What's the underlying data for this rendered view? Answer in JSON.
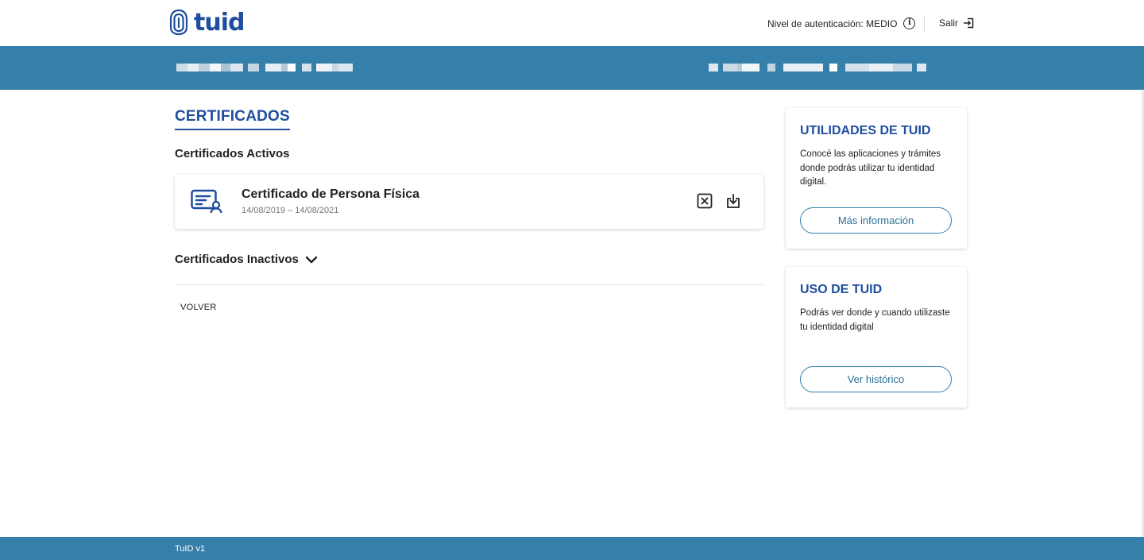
{
  "header": {
    "logo_text": "tuid",
    "auth_label": "Nivel de autenticación: MEDIO",
    "logout_label": "Salir"
  },
  "main": {
    "title": "CERTIFICADOS",
    "active_heading": "Certificados Activos",
    "certificate": {
      "name": "Certificado de Persona Física",
      "dates": "14/08/2019 – 14/08/2021"
    },
    "inactive_heading": "Certificados Inactivos",
    "back_label": "VOLVER"
  },
  "sidebar": {
    "utilities": {
      "title": "UTILIDADES DE TUID",
      "text": "Conocé las aplicaciones y trámites donde podrás utilizar tu identidad digital.",
      "button": "Más información"
    },
    "usage": {
      "title": "USO DE TUID",
      "text": "Podrás ver donde y cuando utilizaste tu identidad digital",
      "button": "Ver histórico"
    }
  },
  "footer": {
    "version": "TuID v1"
  },
  "colors": {
    "brand_blue": "#1f4e9e",
    "banner_blue": "#3580aa"
  }
}
